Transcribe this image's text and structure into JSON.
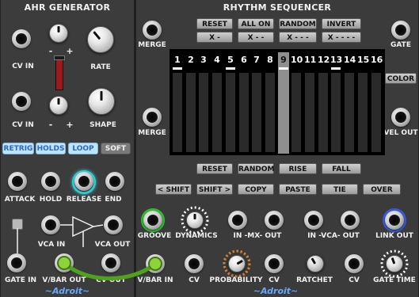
{
  "ahr": {
    "title": "AHR GENERATOR",
    "labels": {
      "cv_in_1": "CV IN",
      "cv_in_2": "CV IN",
      "rate": "RATE",
      "shape": "SHAPE",
      "minus1": "-",
      "plus1": "+",
      "minus2": "-",
      "plus2": "+",
      "attack": "ATTACK",
      "hold": "HOLD",
      "release": "RELEASE",
      "end": "END",
      "vca_in": "VCA IN",
      "vca_out": "VCA OUT",
      "gate_in": "GATE IN",
      "vbar_out": "V/BAR OUT",
      "cv_out": "CV OUT"
    },
    "modes": [
      {
        "label": "RETRIG",
        "state": "on"
      },
      {
        "label": "HOLDS",
        "state": "on"
      },
      {
        "label": "LOOP",
        "state": "on"
      },
      {
        "label": "SOFT",
        "state": "off"
      }
    ],
    "brand": "~Adroit~"
  },
  "seq": {
    "title": "RHYTHM SEQUENCER",
    "labels": {
      "merge1": "MERGE",
      "merge2": "MERGE",
      "gate": "GATE",
      "color": "COLOR",
      "vel_out": "VEL OUT",
      "groove": "GROOVE",
      "dynamics": "DYNAMICS",
      "in_mx_out": "IN -MX- OUT",
      "in_vca_out": "IN -VCA- OUT",
      "link_out": "LINK OUT",
      "vbar_in": "V/BAR IN",
      "cv1": "CV",
      "probability": "PROBABILITY",
      "cv2": "CV",
      "ratchet": "RATCHET",
      "cv3": "CV",
      "gate_time": "GATE TIME"
    },
    "top_buttons": [
      "RESET",
      "ALL ON",
      "RANDOM",
      "INVERT"
    ],
    "pattern_buttons": [
      "X -",
      "X - -",
      "X - - -",
      "X - - - -"
    ],
    "steps": [
      {
        "n": "1",
        "active": true
      },
      {
        "n": "2",
        "active": false
      },
      {
        "n": "3",
        "active": false
      },
      {
        "n": "4",
        "active": false
      },
      {
        "n": "5",
        "active": true
      },
      {
        "n": "6",
        "active": false
      },
      {
        "n": "7",
        "active": false
      },
      {
        "n": "8",
        "active": false
      },
      {
        "n": "9",
        "active": true
      },
      {
        "n": "10",
        "active": false
      },
      {
        "n": "11",
        "active": false
      },
      {
        "n": "12",
        "active": false
      },
      {
        "n": "13",
        "active": true
      },
      {
        "n": "14",
        "active": false
      },
      {
        "n": "15",
        "active": false
      },
      {
        "n": "16",
        "active": false
      }
    ],
    "cursor_step": 9,
    "row1_buttons": [
      "RESET",
      "RANDOM",
      "RISE",
      "FALL"
    ],
    "row2_buttons": [
      "< SHIFT",
      "SHIFT >",
      "COPY",
      "PASTE",
      "TIE",
      "OVER"
    ],
    "brand": "~Adroit~"
  },
  "colors": {
    "panel": "#3b3b3b",
    "mode_on": "#bfe4f8",
    "mode_text": "#2a67c9",
    "slider": "#a01818",
    "cable": "#4fa21c",
    "brand": "#6aa8ff",
    "groove_ring": "#2fbf2f",
    "release_ring": "#38d0d8",
    "link_ring": "#3b5bd8"
  }
}
